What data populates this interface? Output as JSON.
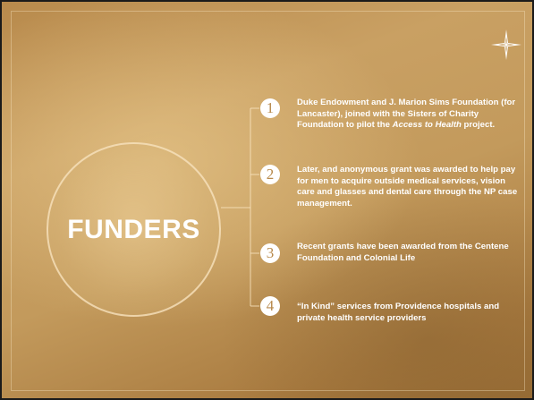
{
  "slide": {
    "title": "FUNDERS",
    "items": [
      {
        "number": "1",
        "text_before": "Duke Endowment and J. Marion Sims Foundation (for Lancaster), joined with the Sisters of Charity Foundation to pilot the ",
        "text_emphasis": "Access to Health",
        "text_after": " project."
      },
      {
        "number": "2",
        "text": "Later, and anonymous grant was awarded to help pay for men to acquire outside medical services, vision care and glasses and dental care through the NP case management."
      },
      {
        "number": "3",
        "text": "Recent grants have been awarded from the Centene Foundation and Colonial Life"
      },
      {
        "number": "4",
        "text": "“In Kind” services from Providence hospitals and private health service providers"
      }
    ]
  },
  "colors": {
    "background": "#c39a5c",
    "text": "#ffffff",
    "accent": "#b88a4c"
  },
  "icons": {
    "corner_ornament": "sparkle-icon"
  }
}
